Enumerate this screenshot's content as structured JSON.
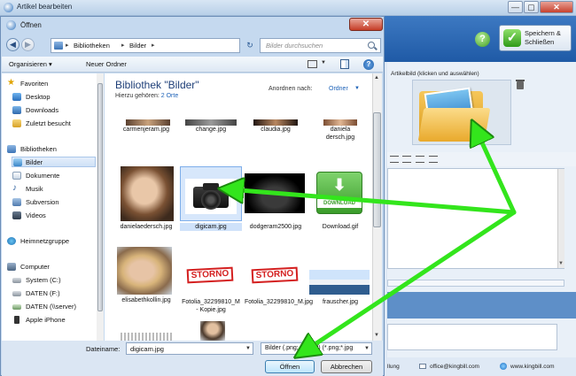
{
  "bg_window": {
    "title": "Artikel bearbeiten",
    "min_glyph": "—",
    "max_glyph": "▢",
    "close_glyph": "✕",
    "help_glyph": "?",
    "save_label": "Speichern & Schließen",
    "artikelbild_label": "Artikelbild (klicken und auswählen)",
    "footer_email": "office@kingbill.com",
    "footer_web": "www.kingbill.com",
    "footer_partial": "llung"
  },
  "dialog": {
    "title": "Öffnen",
    "close_glyph": "✕",
    "address": {
      "segments": [
        "Bibliotheken",
        "Bilder"
      ],
      "separator": "▸"
    },
    "search_placeholder": "Bilder durchsuchen",
    "toolbar": {
      "organize": "Organisieren ▾",
      "new_folder": "Neuer Ordner"
    },
    "library": {
      "title": "Bibliothek \"Bilder\"",
      "includes_prefix": "Hierzu gehören:",
      "includes_link": "2 Orte",
      "sort_label": "Anordnen nach:",
      "sort_value": "Ordner"
    },
    "nav": {
      "favorites_header": "Favoriten",
      "favorites": [
        "Desktop",
        "Downloads",
        "Zuletzt besucht"
      ],
      "libraries_header": "Bibliotheken",
      "libraries": [
        "Bilder",
        "Dokumente",
        "Musik",
        "Subversion",
        "Videos"
      ],
      "homegroup": "Heimnetzgruppe",
      "computer_header": "Computer",
      "drives": [
        "System (C:)",
        "DATEN (F:)",
        "DATEN (\\\\server)",
        "Apple iPhone"
      ],
      "selected": "Bilder"
    },
    "files": [
      {
        "name": "carmenjeram.jpg",
        "kind": "portrait-dark"
      },
      {
        "name": "change.jpg",
        "kind": "photo-gray"
      },
      {
        "name": "claudia.jpg",
        "kind": "portrait-dark"
      },
      {
        "name": "daniela dersch.jpg",
        "kind": "portrait-warm"
      },
      {
        "name": "danielaedersch.jpg",
        "kind": "portrait-smile"
      },
      {
        "name": "digicam.jpg",
        "kind": "camera"
      },
      {
        "name": "dodgeram2500.jpg",
        "kind": "car-dark"
      },
      {
        "name": "Download.gif",
        "kind": "download-badge"
      },
      {
        "name": "elisabethkollin.jpg",
        "kind": "portrait-blonde"
      },
      {
        "name": "Fotolia_32299810_M - Kopie.jpg",
        "kind": "storno"
      },
      {
        "name": "Fotolia_32299810_M.jpg",
        "kind": "storno"
      },
      {
        "name": "frauscher.jpg",
        "kind": "boat"
      },
      {
        "name": "",
        "kind": "partial-paper"
      },
      {
        "name": "",
        "kind": "partial-portrait"
      }
    ],
    "selected_file": "digicam.jpg",
    "storno_text": "STORNO",
    "download_text": "DOWNLOAD",
    "filename_label": "Dateiname:",
    "filename_value": "digicam.jpg",
    "filter_value": "Bilder (.png;.jpg;.gif) (*.png;*.jpg",
    "open_button": "Öffnen",
    "cancel_button": "Abbrechen"
  },
  "colors": {
    "accent_arrow": "#33e51c",
    "title_blue": "#1e3f78",
    "link_blue": "#1d62b8"
  }
}
